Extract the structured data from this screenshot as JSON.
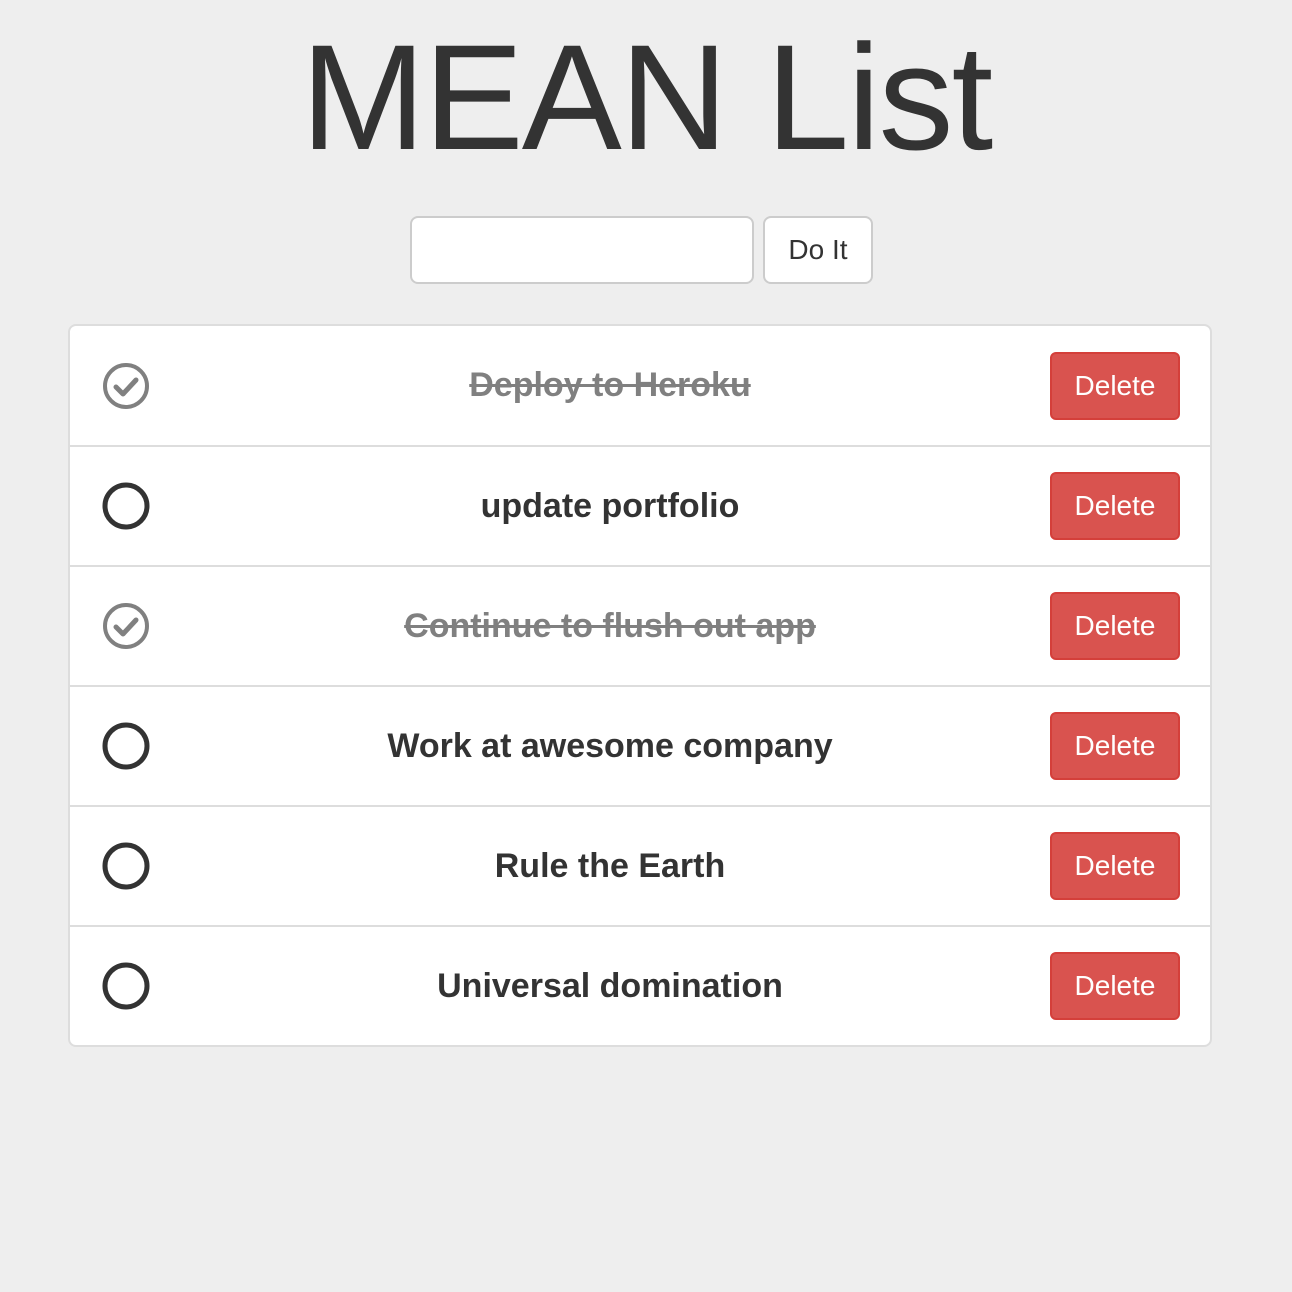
{
  "header": {
    "title": "MEAN List"
  },
  "add_form": {
    "input_value": "",
    "input_placeholder": "",
    "button_label": "Do It"
  },
  "tasks": [
    {
      "text": "Deploy to Heroku",
      "done": true,
      "delete_label": "Delete",
      "icon": "check-circle-icon"
    },
    {
      "text": "update portfolio",
      "done": false,
      "delete_label": "Delete",
      "icon": "circle-icon"
    },
    {
      "text": "Continue to flush out app",
      "done": true,
      "delete_label": "Delete",
      "icon": "check-circle-icon"
    },
    {
      "text": "Work at awesome company",
      "done": false,
      "delete_label": "Delete",
      "icon": "circle-icon"
    },
    {
      "text": "Rule the Earth",
      "done": false,
      "delete_label": "Delete",
      "icon": "circle-icon"
    },
    {
      "text": "Universal domination",
      "done": false,
      "delete_label": "Delete",
      "icon": "circle-icon"
    }
  ],
  "colors": {
    "background": "#eeeeee",
    "text": "#333333",
    "done_text": "#808080",
    "delete_button": "#d9534f",
    "delete_border": "#d43f3a"
  }
}
